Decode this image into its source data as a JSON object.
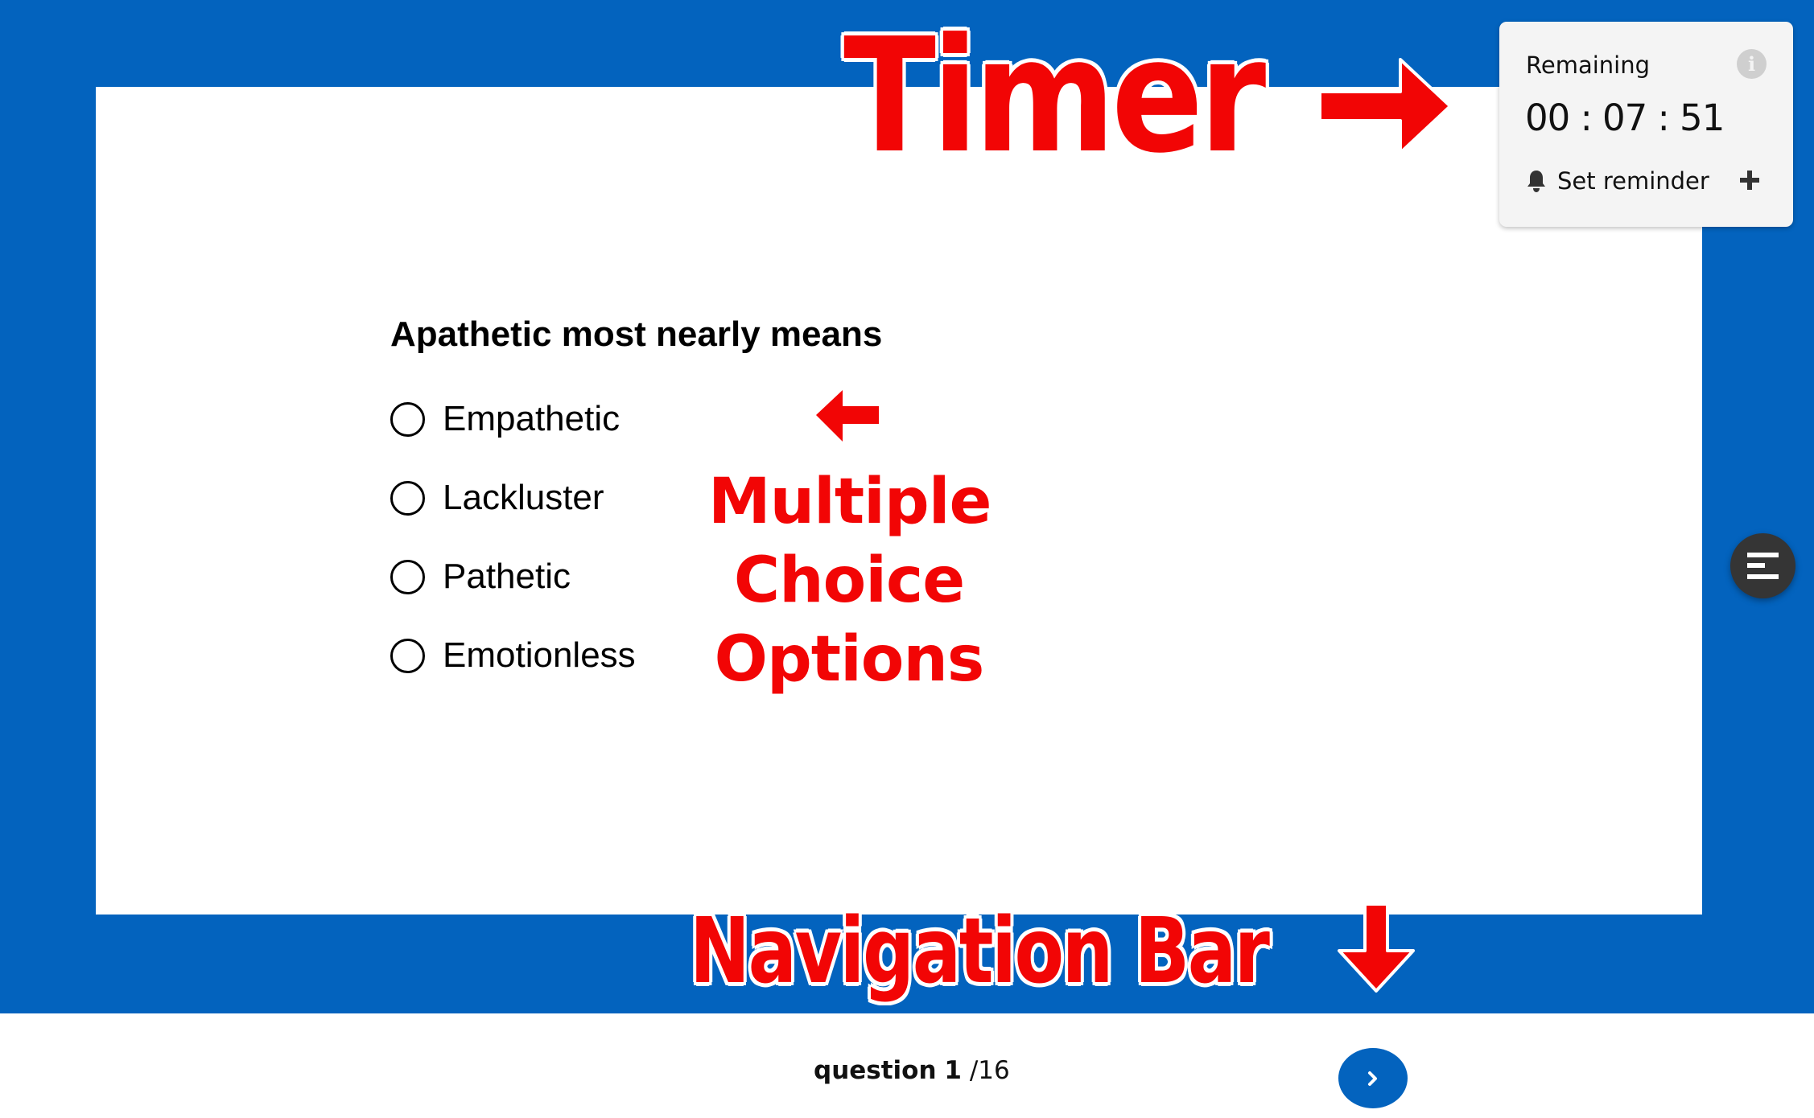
{
  "theme": {
    "brand_blue": "#0363BE",
    "annotation_red": "#F20505",
    "menu_fab_color": "#353535",
    "timer_panel_bg": "#F4F4F4"
  },
  "question": {
    "prompt": "Apathetic most nearly means",
    "options": [
      {
        "label": "Empathetic",
        "selected": false
      },
      {
        "label": "Lackluster",
        "selected": false
      },
      {
        "label": "Pathetic",
        "selected": false
      },
      {
        "label": "Emotionless",
        "selected": false
      }
    ]
  },
  "timer": {
    "label": "Remaining",
    "value": "00 : 07 : 51",
    "info_icon": "info-circle-icon",
    "reminder_label": "Set reminder",
    "reminder_icon": "bell-icon",
    "add_icon": "plus-icon"
  },
  "side_menu": {
    "icon": "menu-lines-icon"
  },
  "navigation": {
    "question_word": "question",
    "current_number": "1",
    "total": "/16",
    "next_icon": "chevron-right-icon"
  },
  "annotations": {
    "timer": "Timer",
    "multiple_choice_line1": "Multiple",
    "multiple_choice_line2": "Choice",
    "multiple_choice_line3": "Options",
    "navigation_bar": "Navigation Bar"
  }
}
